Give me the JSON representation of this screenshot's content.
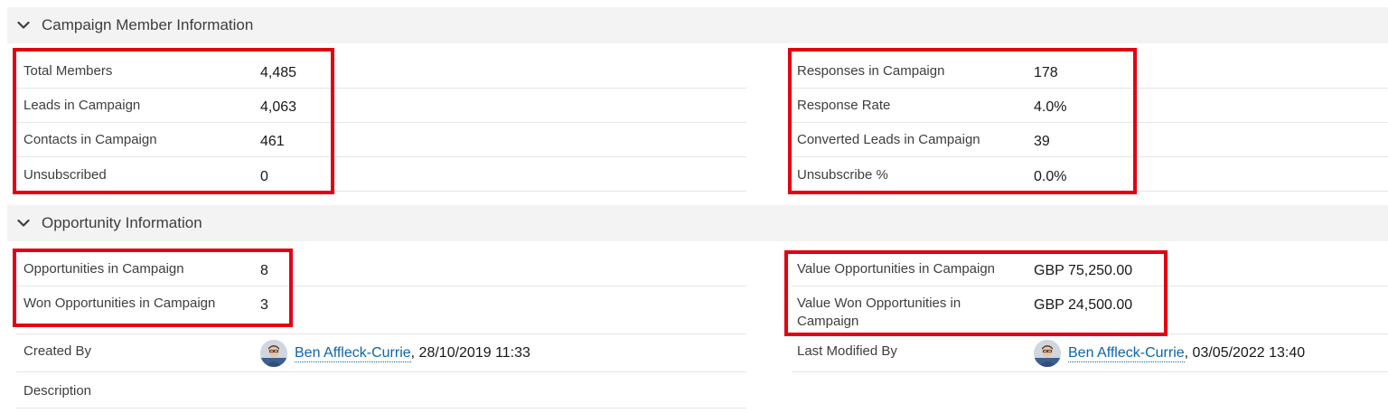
{
  "campaign_member_section": {
    "title": "Campaign Member Information",
    "left_fields": [
      {
        "label": "Total Members",
        "value": "4,485"
      },
      {
        "label": "Leads in Campaign",
        "value": "4,063"
      },
      {
        "label": "Contacts in Campaign",
        "value": "461"
      },
      {
        "label": "Unsubscribed",
        "value": "0"
      }
    ],
    "right_fields": [
      {
        "label": "Responses in Campaign",
        "value": "178"
      },
      {
        "label": "Response Rate",
        "value": "4.0%"
      },
      {
        "label": "Converted Leads in Campaign",
        "value": "39"
      },
      {
        "label": "Unsubscribe %",
        "value": "0.0%"
      }
    ]
  },
  "opportunity_section": {
    "title": "Opportunity Information",
    "left_fields": [
      {
        "label": "Opportunities in Campaign",
        "value": "8"
      },
      {
        "label": "Won Opportunities in Campaign",
        "value": "3"
      }
    ],
    "right_fields": [
      {
        "label": "Value Opportunities in Campaign",
        "value": "GBP 75,250.00"
      },
      {
        "label": "Value Won Opportunities in",
        "label_line2": "Campaign",
        "value": "GBP 24,500.00"
      }
    ]
  },
  "system_info": {
    "created_by": {
      "label": "Created By",
      "user": "Ben Affleck-Currie",
      "timestamp": ", 28/10/2019 11:33"
    },
    "last_modified_by": {
      "label": "Last Modified By",
      "user": "Ben Affleck-Currie",
      "timestamp": ", 03/05/2022 13:40"
    },
    "description": {
      "label": "Description",
      "value": ""
    }
  },
  "colors": {
    "highlight": "#e3000f",
    "link": "#0b64b0",
    "section_bg": "#f3f3f3"
  }
}
